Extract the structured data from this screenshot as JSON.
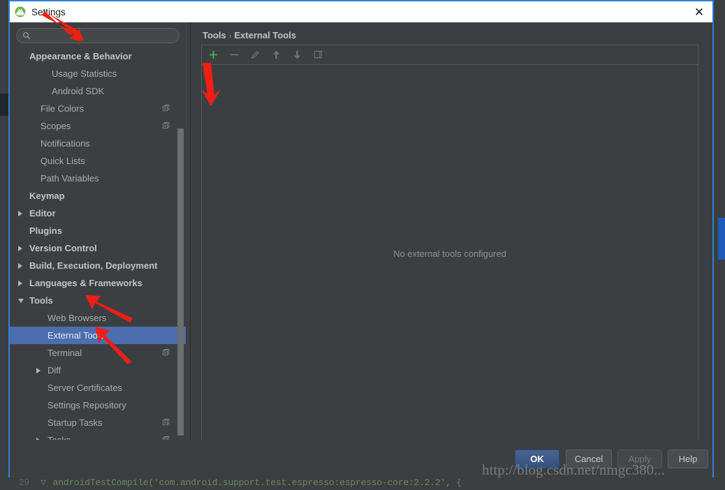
{
  "window": {
    "title": "Settings",
    "icon": "android-robot-icon",
    "close_label": "✕"
  },
  "search": {
    "value": "",
    "placeholder": "",
    "icon": "search-icon"
  },
  "sidebar": {
    "items": [
      {
        "label": "Appearance & Behavior",
        "indent": 28,
        "bold": true,
        "arrow": "none",
        "copy": false,
        "selected": false
      },
      {
        "label": "Usage Statistics",
        "indent": 60,
        "bold": false,
        "arrow": "none",
        "copy": false,
        "selected": false
      },
      {
        "label": "Android SDK",
        "indent": 60,
        "bold": false,
        "arrow": "none",
        "copy": false,
        "selected": false
      },
      {
        "label": "File Colors",
        "indent": 44,
        "bold": false,
        "arrow": "none",
        "copy": true,
        "selected": false
      },
      {
        "label": "Scopes",
        "indent": 44,
        "bold": false,
        "arrow": "none",
        "copy": true,
        "selected": false
      },
      {
        "label": "Notifications",
        "indent": 44,
        "bold": false,
        "arrow": "none",
        "copy": false,
        "selected": false
      },
      {
        "label": "Quick Lists",
        "indent": 44,
        "bold": false,
        "arrow": "none",
        "copy": false,
        "selected": false
      },
      {
        "label": "Path Variables",
        "indent": 44,
        "bold": false,
        "arrow": "none",
        "copy": false,
        "selected": false
      },
      {
        "label": "Keymap",
        "indent": 28,
        "bold": true,
        "arrow": "none",
        "copy": false,
        "selected": false
      },
      {
        "label": "Editor",
        "indent": 28,
        "bold": true,
        "arrow": "right",
        "copy": false,
        "selected": false
      },
      {
        "label": "Plugins",
        "indent": 28,
        "bold": true,
        "arrow": "none",
        "copy": false,
        "selected": false
      },
      {
        "label": "Version Control",
        "indent": 28,
        "bold": true,
        "arrow": "right",
        "copy": false,
        "selected": false
      },
      {
        "label": "Build, Execution, Deployment",
        "indent": 28,
        "bold": true,
        "arrow": "right",
        "copy": false,
        "selected": false
      },
      {
        "label": "Languages & Frameworks",
        "indent": 28,
        "bold": true,
        "arrow": "right",
        "copy": false,
        "selected": false
      },
      {
        "label": "Tools",
        "indent": 28,
        "bold": true,
        "arrow": "down",
        "copy": false,
        "selected": false
      },
      {
        "label": "Web Browsers",
        "indent": 54,
        "bold": false,
        "arrow": "none",
        "copy": false,
        "selected": false
      },
      {
        "label": "External Tools",
        "indent": 54,
        "bold": false,
        "arrow": "none",
        "copy": false,
        "selected": true
      },
      {
        "label": "Terminal",
        "indent": 54,
        "bold": false,
        "arrow": "none",
        "copy": true,
        "selected": false
      },
      {
        "label": "Diff",
        "indent": 54,
        "bold": false,
        "arrow": "right",
        "copy": false,
        "selected": false
      },
      {
        "label": "Server Certificates",
        "indent": 54,
        "bold": false,
        "arrow": "none",
        "copy": false,
        "selected": false
      },
      {
        "label": "Settings Repository",
        "indent": 54,
        "bold": false,
        "arrow": "none",
        "copy": false,
        "selected": false
      },
      {
        "label": "Startup Tasks",
        "indent": 54,
        "bold": false,
        "arrow": "none",
        "copy": true,
        "selected": false
      },
      {
        "label": "Tasks",
        "indent": 54,
        "bold": false,
        "arrow": "right",
        "copy": true,
        "selected": false
      }
    ]
  },
  "main": {
    "breadcrumb_root": "Tools",
    "breadcrumb_sep": "›",
    "breadcrumb_current": "External Tools",
    "empty_message": "No external tools configured",
    "toolbar": [
      {
        "name": "add-tool-button",
        "icon": "plus-icon",
        "enabled": true
      },
      {
        "name": "remove-tool-button",
        "icon": "minus-icon",
        "enabled": false
      },
      {
        "name": "edit-tool-button",
        "icon": "pencil-icon",
        "enabled": false
      },
      {
        "name": "move-up-button",
        "icon": "arrow-up-icon",
        "enabled": false
      },
      {
        "name": "move-down-button",
        "icon": "arrow-down-icon",
        "enabled": false
      },
      {
        "name": "copy-tool-button",
        "icon": "copy-icon",
        "enabled": false
      }
    ]
  },
  "buttons": {
    "ok": "OK",
    "cancel": "Cancel",
    "apply": "Apply",
    "help": "Help"
  },
  "watermark": {
    "text": "http://blog.csdn.net/nmgc380..."
  },
  "ide_background": {
    "code_line_number": "29",
    "code_text": "androidTestCompile('com.android.support.test.espresso:espresso-core:2.2.2', {"
  },
  "colors": {
    "accent_blue": "#2f7fd4",
    "selection_blue": "#4b6eaf",
    "panel_bg": "#3c3f41",
    "plus_green": "#4caf50",
    "annotation_red": "#f01e14"
  }
}
